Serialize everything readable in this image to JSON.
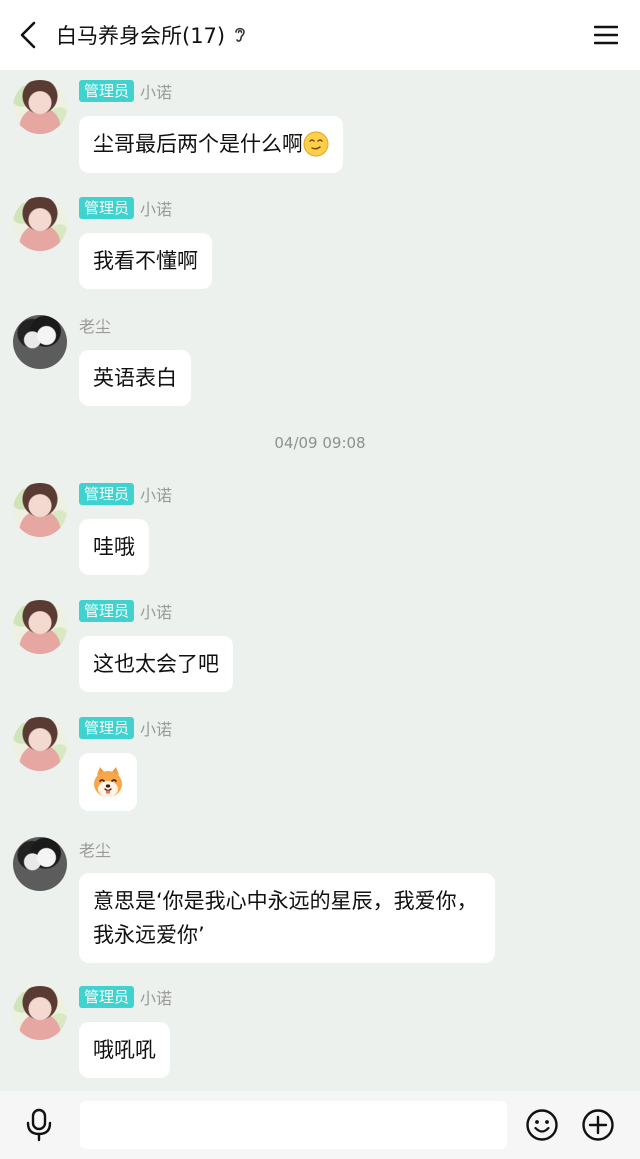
{
  "header": {
    "title": "白马养身会所(17)",
    "back_icon": "chevron-left-icon",
    "ear_icon": "ear-icon",
    "menu_icon": "hamburger-menu-icon"
  },
  "messages": [
    {
      "sender": "小诺",
      "badge": "管理员",
      "text": "尘哥最后两个是什么啊",
      "emoji": "smirk-face"
    },
    {
      "sender": "小诺",
      "badge": "管理员",
      "text": "我看不懂啊"
    },
    {
      "sender": "老尘",
      "text": "英语表白"
    },
    {
      "time": "04/09 09:08"
    },
    {
      "sender": "小诺",
      "badge": "管理员",
      "text": "哇哦"
    },
    {
      "sender": "小诺",
      "badge": "管理员",
      "text": "这也太会了吧"
    },
    {
      "sender": "小诺",
      "badge": "管理员",
      "text": "",
      "emoji": "shiba-dog-face"
    },
    {
      "sender": "老尘",
      "text": "意思是‘你是我心中永远的星辰，我爱你，我永远爱你’"
    },
    {
      "sender": "小诺",
      "badge": "管理员",
      "text": "哦吼吼"
    }
  ],
  "input_bar": {
    "mic_icon": "microphone-icon",
    "input_value": "",
    "emoji_icon": "smiley-icon",
    "plus_icon": "plus-circle-icon"
  },
  "colors": {
    "chat_bg": "#edf1ee",
    "badge": "#3fd2cf",
    "bubble": "#ffffff"
  }
}
